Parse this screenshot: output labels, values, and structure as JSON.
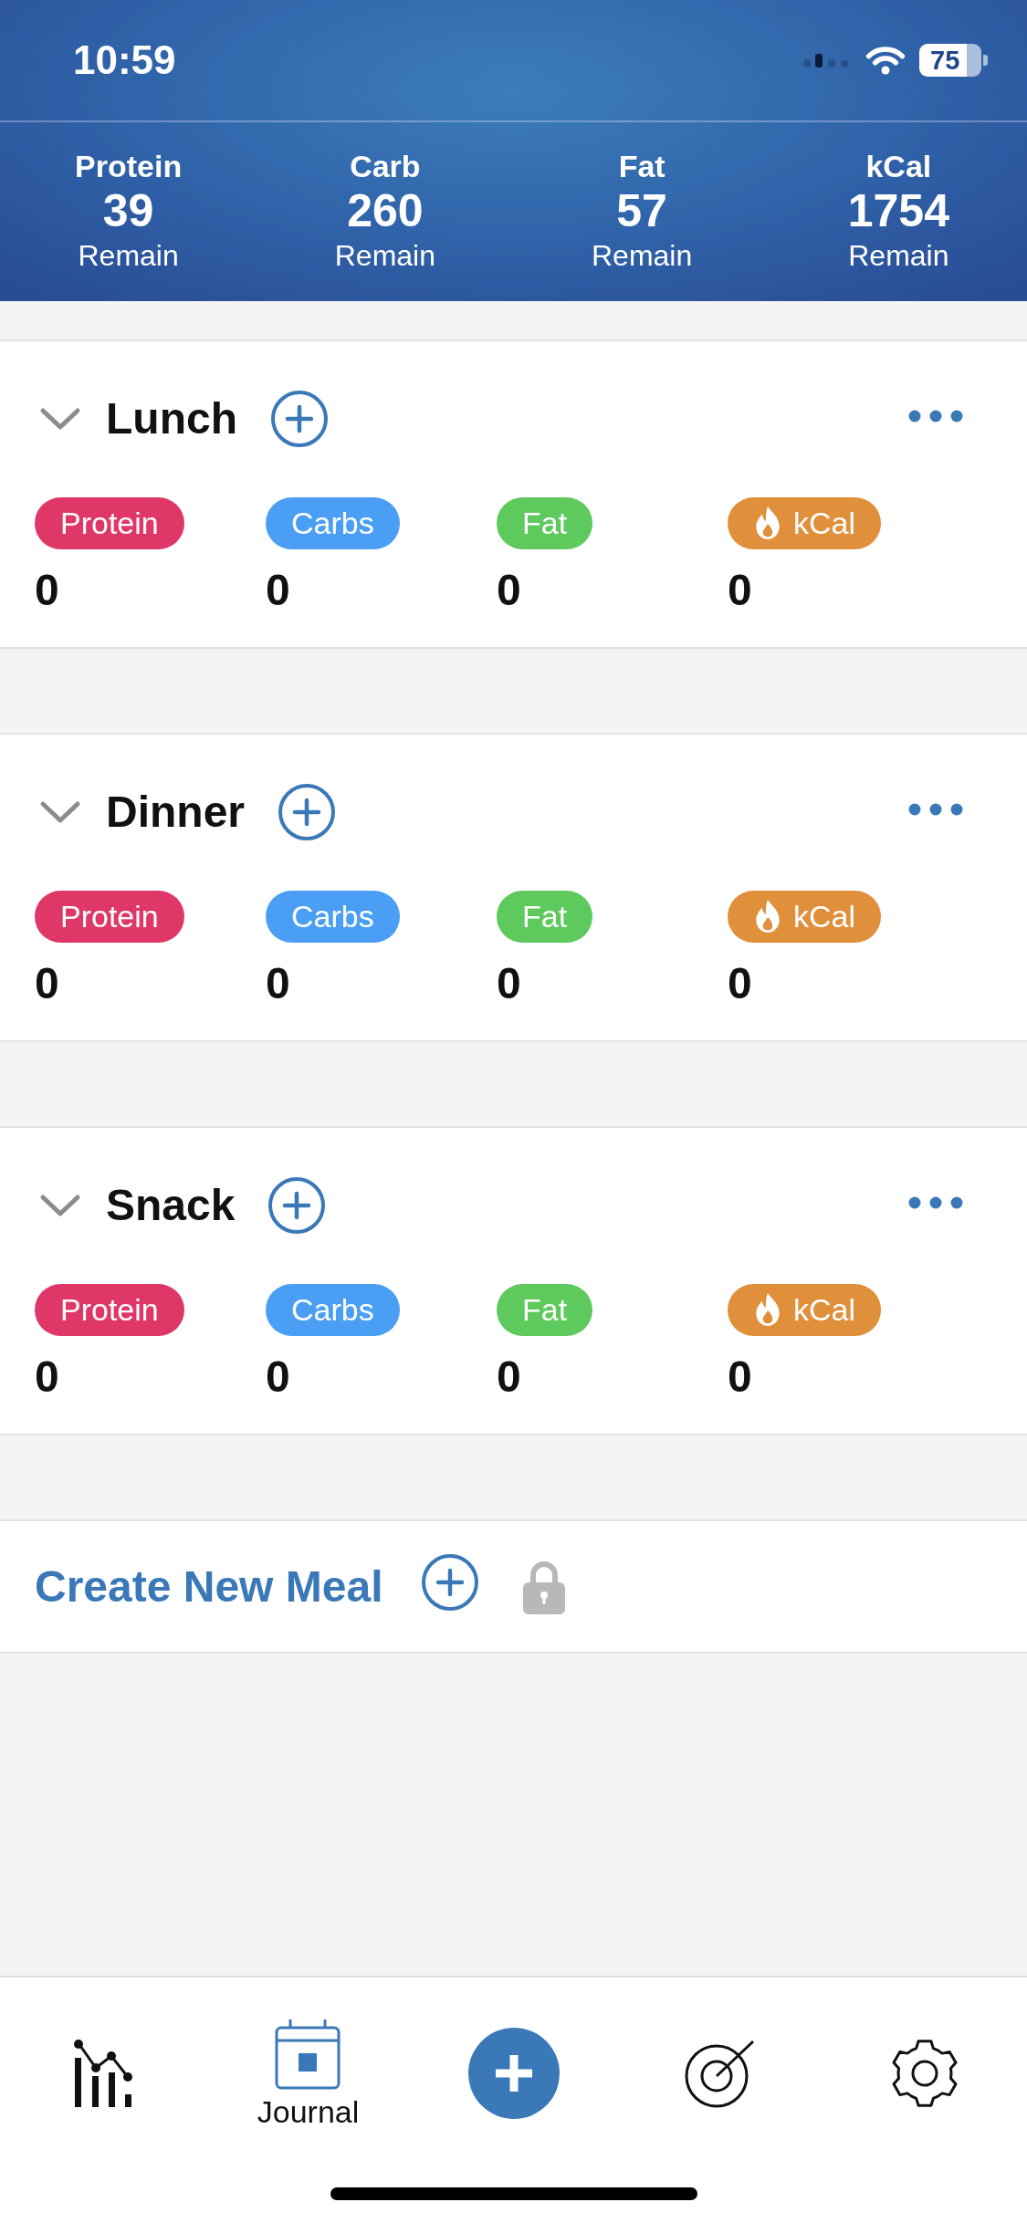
{
  "status_bar": {
    "time": "10:59",
    "battery": "75"
  },
  "summary": [
    {
      "label": "Protein",
      "value": "39",
      "caption": "Remain"
    },
    {
      "label": "Carb",
      "value": "260",
      "caption": "Remain"
    },
    {
      "label": "Fat",
      "value": "57",
      "caption": "Remain"
    },
    {
      "label": "kCal",
      "value": "1754",
      "caption": "Remain"
    }
  ],
  "meals": [
    {
      "title": "Lunch",
      "macros": [
        {
          "kind": "plain",
          "label": "Protein",
          "color": "#de3768",
          "value": "0"
        },
        {
          "kind": "plain",
          "label": "Carbs",
          "color": "#4a9ff5",
          "value": "0"
        },
        {
          "kind": "plain",
          "label": "Fat",
          "color": "#5ec95c",
          "value": "0"
        },
        {
          "kind": "energy",
          "label": "kCal",
          "color": "#e08f3a",
          "value": "0"
        }
      ]
    },
    {
      "title": "Dinner",
      "macros": [
        {
          "kind": "plain",
          "label": "Protein",
          "color": "#de3768",
          "value": "0"
        },
        {
          "kind": "plain",
          "label": "Carbs",
          "color": "#4a9ff5",
          "value": "0"
        },
        {
          "kind": "plain",
          "label": "Fat",
          "color": "#5ec95c",
          "value": "0"
        },
        {
          "kind": "energy",
          "label": "kCal",
          "color": "#e08f3a",
          "value": "0"
        }
      ]
    },
    {
      "title": "Snack",
      "macros": [
        {
          "kind": "plain",
          "label": "Protein",
          "color": "#de3768",
          "value": "0"
        },
        {
          "kind": "plain",
          "label": "Carbs",
          "color": "#4a9ff5",
          "value": "0"
        },
        {
          "kind": "plain",
          "label": "Fat",
          "color": "#5ec95c",
          "value": "0"
        },
        {
          "kind": "energy",
          "label": "kCal",
          "color": "#e08f3a",
          "value": "0"
        }
      ]
    }
  ],
  "create_meal": {
    "label": "Create New Meal",
    "locked": true
  },
  "tab_bar": [
    {
      "kind": "stats",
      "selected": false
    },
    {
      "kind": "journal",
      "label": "Journal",
      "selected": true
    },
    {
      "kind": "add",
      "selected": false
    },
    {
      "kind": "goals",
      "selected": false
    },
    {
      "kind": "settings",
      "selected": false
    }
  ]
}
